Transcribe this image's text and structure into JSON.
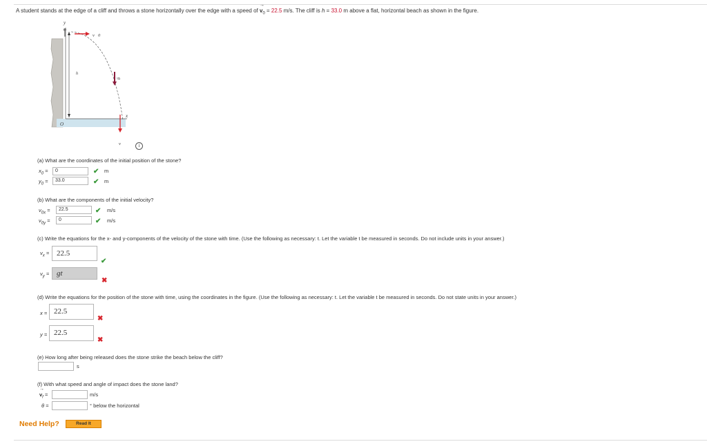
{
  "problem": {
    "intro": "A student stands at the edge of a cliff and throws a stone horizontally over the edge with a speed of",
    "v0_symbol": "v",
    "v0_sub": "0",
    "v0_eq": " = ",
    "v0_value": "22.5",
    "v0_unit": " m/s. The cliff is ",
    "h_symbol": "h",
    "h_eq": " = ",
    "h_value": "33.0",
    "tail": " m above a flat, horizontal beach as shown in the figure."
  },
  "figure": {
    "y_axis": "y",
    "x_axis": "x",
    "origin": "O",
    "h_label": "h",
    "v0_label": "v⃗0",
    "g_label": "g⃗",
    "v_label": "v⃗",
    "info_icon_glyph": "i"
  },
  "part_a": {
    "question": "(a) What are the coordinates of the initial position of the stone?",
    "x_label": "x",
    "x_sub": "0",
    "y_label": "y",
    "y_sub": "0",
    "x_value": "0",
    "y_value": "33.0",
    "unit": "m"
  },
  "part_b": {
    "question": "(b) What are the components of the initial velocity?",
    "vx_label": "v",
    "vx_sub": "0x",
    "vy_label": "v",
    "vy_sub": "0y",
    "vx_value": "22.5",
    "vy_value": "0",
    "unit": "m/s"
  },
  "part_c": {
    "question": "(c) Write the equations for the x- and y-components of the velocity of the stone with time. (Use the following as necessary: t. Let the variable t be measured in seconds. Do not include units in your answer.)",
    "vx_label": "v",
    "vx_sub": "x",
    "vy_label": "v",
    "vy_sub": "y",
    "vx_value": "22.5",
    "vy_value": "gt"
  },
  "part_d": {
    "question": "(d) Write the equations for the position of the stone with time, using the coordinates in the figure. (Use the following as necessary: t. Let the variable t be measured in seconds. Do not state units in your answer.)",
    "x_label": "x",
    "y_label": "y",
    "x_value": "22.5",
    "y_value": "22.5"
  },
  "part_e": {
    "question": "(e) How long after being released does the stone strike the beach below the cliff?",
    "unit": "s",
    "value": ""
  },
  "part_f": {
    "question": "(f) With what speed and angle of impact does the stone land?",
    "vf_label": "v",
    "vf_sub": "f",
    "theta_label": "θ",
    "speed_unit": "m/s",
    "angle_unit": "° below the horizontal",
    "speed_value": "",
    "angle_value": ""
  },
  "help": {
    "label": "Need Help?",
    "read_it": "Read It"
  },
  "colors": {
    "highlight_red": "#c8102e",
    "correct_green": "#3c9a3c",
    "wrong_red": "#d7262e",
    "help_orange": "#e07b00",
    "button_orange": "#f7a829"
  },
  "icons": {
    "correct": "checkmark-icon",
    "incorrect": "x-mark-icon"
  }
}
